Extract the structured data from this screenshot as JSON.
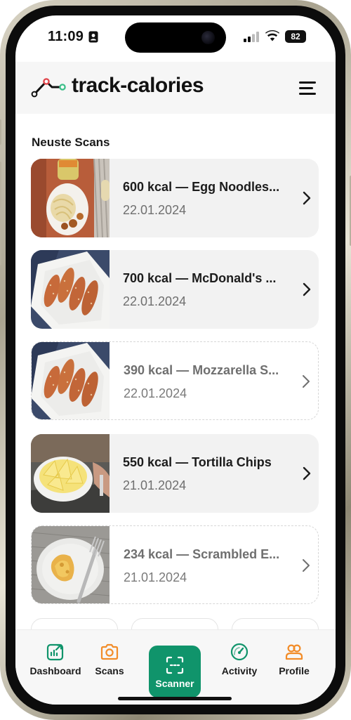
{
  "status_bar": {
    "time": "11:09",
    "battery": "82"
  },
  "header": {
    "app_title": "track-calories",
    "logo_icon": "chart-line-logo-icon",
    "menu_icon": "hamburger-menu-icon"
  },
  "section": {
    "title": "Neuste Scans"
  },
  "scans": [
    {
      "title": "600 kcal — Egg Noodles...",
      "date": "22.01.2024",
      "style": "filled",
      "thumb": "egg-noodles-plate"
    },
    {
      "title": "700 kcal — McDonald's ...",
      "date": "22.01.2024",
      "style": "filled",
      "thumb": "breaded-strips-tray"
    },
    {
      "title": "390 kcal — Mozzarella S...",
      "date": "22.01.2024",
      "style": "dashed",
      "thumb": "breaded-strips-tray"
    },
    {
      "title": "550 kcal — Tortilla Chips",
      "date": "21.01.2024",
      "style": "filled",
      "thumb": "tortilla-chips-bowl"
    },
    {
      "title": "234 kcal — Scrambled E...",
      "date": "21.01.2024",
      "style": "dashed",
      "thumb": "scrambled-eggs-plate"
    }
  ],
  "bottom_nav": {
    "items": [
      {
        "label": "Dashboard",
        "icon": "dashboard-chart-icon",
        "color": "#10946b"
      },
      {
        "label": "Scans",
        "icon": "camera-icon",
        "color": "#f28c28"
      },
      {
        "label": "Scanner",
        "icon": "scan-frame-icon",
        "color": "#ffffff"
      },
      {
        "label": "Activity",
        "icon": "speedometer-icon",
        "color": "#10946b"
      },
      {
        "label": "Profile",
        "icon": "users-icon",
        "color": "#f28c28"
      }
    ]
  },
  "colors": {
    "accent_green": "#10946b",
    "accent_orange": "#f28c28",
    "logo_red": "#e0464c",
    "logo_green": "#3fbf8a"
  }
}
